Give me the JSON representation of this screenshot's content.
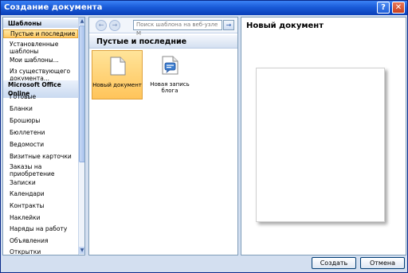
{
  "window": {
    "title": "Создание документа",
    "help_label": "?",
    "close_label": "✕"
  },
  "left_panel": {
    "items": [
      {
        "label": "Шаблоны",
        "kind": "header"
      },
      {
        "label": "Пустые и последние",
        "kind": "selected"
      },
      {
        "label": "Установленные шаблоны",
        "kind": "item"
      },
      {
        "label": "Мои шаблоны...",
        "kind": "item"
      },
      {
        "label": "Из существующего документа...",
        "kind": "item"
      },
      {
        "label": "Microsoft Office Online",
        "kind": "header"
      },
      {
        "label": "Готовые",
        "kind": "item"
      },
      {
        "label": "Бланки",
        "kind": "item"
      },
      {
        "label": "Брошюры",
        "kind": "item"
      },
      {
        "label": "Бюллетени",
        "kind": "item"
      },
      {
        "label": "Ведомости",
        "kind": "item"
      },
      {
        "label": "Визитные карточки",
        "kind": "item"
      },
      {
        "label": "Заказы на приобретение",
        "kind": "item"
      },
      {
        "label": "Записки",
        "kind": "item"
      },
      {
        "label": "Календари",
        "kind": "item"
      },
      {
        "label": "Контракты",
        "kind": "item"
      },
      {
        "label": "Наклейки",
        "kind": "item"
      },
      {
        "label": "Наряды на работу",
        "kind": "item"
      },
      {
        "label": "Объявления",
        "kind": "item"
      },
      {
        "label": "Открытки",
        "kind": "item"
      }
    ]
  },
  "middle_panel": {
    "search_placeholder": "Поиск шаблона на веб-узле M",
    "nav_back": "←",
    "nav_forward": "→",
    "go_label": "→",
    "section_title": "Пустые и последние",
    "templates": [
      {
        "label": "Новый документ",
        "icon": "blank-document-icon",
        "selected": true
      },
      {
        "label": "Новая запись блога",
        "icon": "blog-post-icon",
        "selected": false
      }
    ]
  },
  "right_panel": {
    "title": "Новый документ"
  },
  "buttons": {
    "create": "Создать",
    "cancel": "Отмена"
  }
}
